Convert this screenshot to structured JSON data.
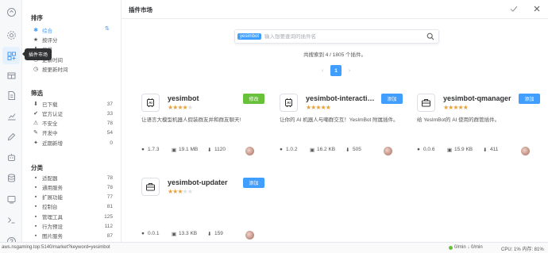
{
  "rail": {
    "icons": [
      "home-icon",
      "settings-icon",
      "plugin-market-icon",
      "box-icon",
      "document-icon",
      "chart-icon",
      "edit-icon",
      "robot-icon",
      "database-icon",
      "sandbox-icon",
      "terminal-icon",
      "help-icon"
    ],
    "active_index": 2,
    "tooltip": "插件市场"
  },
  "sidebar": {
    "sort_title": "排序",
    "sort_items": [
      {
        "label": "综合",
        "icon": "asterisk-icon",
        "active": true
      },
      {
        "label": "按评分",
        "icon": "star-icon",
        "active": false
      },
      {
        "label": "按下载量",
        "icon": "download-icon",
        "active": false
      },
      {
        "label": "按更新时间",
        "icon": "clock-icon",
        "active": false
      },
      {
        "label": "按更新时间",
        "icon": "clock-icon",
        "active": false
      }
    ],
    "sort_items_visible": [
      "综合",
      "按评分",
      "载量",
      "更新时间",
      "按更新时间"
    ],
    "filter_title": "筛选",
    "filter_items": [
      {
        "label": "已下载",
        "count": "37",
        "icon": "download-icon"
      },
      {
        "label": "官方认证",
        "count": "33",
        "icon": "verified-icon"
      },
      {
        "label": "不安全",
        "count": "78",
        "icon": "warning-icon"
      },
      {
        "label": "开发中",
        "count": "54",
        "icon": "wrench-icon"
      },
      {
        "label": "近期新增",
        "count": "0",
        "icon": "sparkle-icon"
      }
    ],
    "category_title": "分类",
    "category_items": [
      {
        "label": "适配器",
        "count": "78"
      },
      {
        "label": "通用服务",
        "count": "78"
      },
      {
        "label": "扩展功能",
        "count": "77"
      },
      {
        "label": "控制台",
        "count": "81"
      },
      {
        "label": "管理工具",
        "count": "125"
      },
      {
        "label": "行为预设",
        "count": "112"
      },
      {
        "label": "图片服务",
        "count": "87"
      }
    ]
  },
  "header": {
    "title": "插件市场"
  },
  "search": {
    "tag": "yesimbot",
    "placeholder": "输入想要查询的插件名"
  },
  "results": {
    "text": "共搜索到 4 / 1805 个插件。"
  },
  "pager": {
    "prev": "‹",
    "current": "1",
    "next": "›"
  },
  "cards": [
    {
      "name": "yesimbot",
      "rating": 4,
      "button": "修改",
      "button_color": "#67c23a",
      "icon": "ai-icon",
      "desc": "让语言大模型机器人假装群友并和群友聊天!",
      "version": "1.7.3",
      "size": "19.1 MB",
      "downloads": "1120"
    },
    {
      "name": "yesimbot-interactions",
      "rating": 5,
      "button": "添加",
      "button_color": "#409eff",
      "icon": "ai-icon",
      "desc": "让你的 AI 机器人与嘲群交互！YesImBot 附属插件。",
      "version": "1.0.2",
      "size": "16.2 KB",
      "downloads": "505"
    },
    {
      "name": "yesimbot-qmanager",
      "rating": 5,
      "button": "添加",
      "button_color": "#409eff",
      "icon": "toolbox-icon",
      "desc": "给 YesImBot的 AI 使用的群管插件。",
      "version": "0.0.6",
      "size": "15.9 KB",
      "downloads": "411"
    },
    {
      "name": "yesimbot-updater",
      "rating": 3,
      "button": "添加",
      "button_color": "#409eff",
      "icon": "toolbox-icon",
      "desc": "",
      "version": "0.0.1",
      "size": "13.3 KB",
      "downloads": "159"
    }
  ],
  "statusbar": {
    "url": "aws.nsgaming.top:5140/market?keyword=yesimbot",
    "network": "0/min ↓ 0/min",
    "cpu": "CPU: 1% 内存: 81%"
  },
  "colors": {
    "accent": "#409eff",
    "success": "#67c23a",
    "star": "#e6a23c"
  }
}
